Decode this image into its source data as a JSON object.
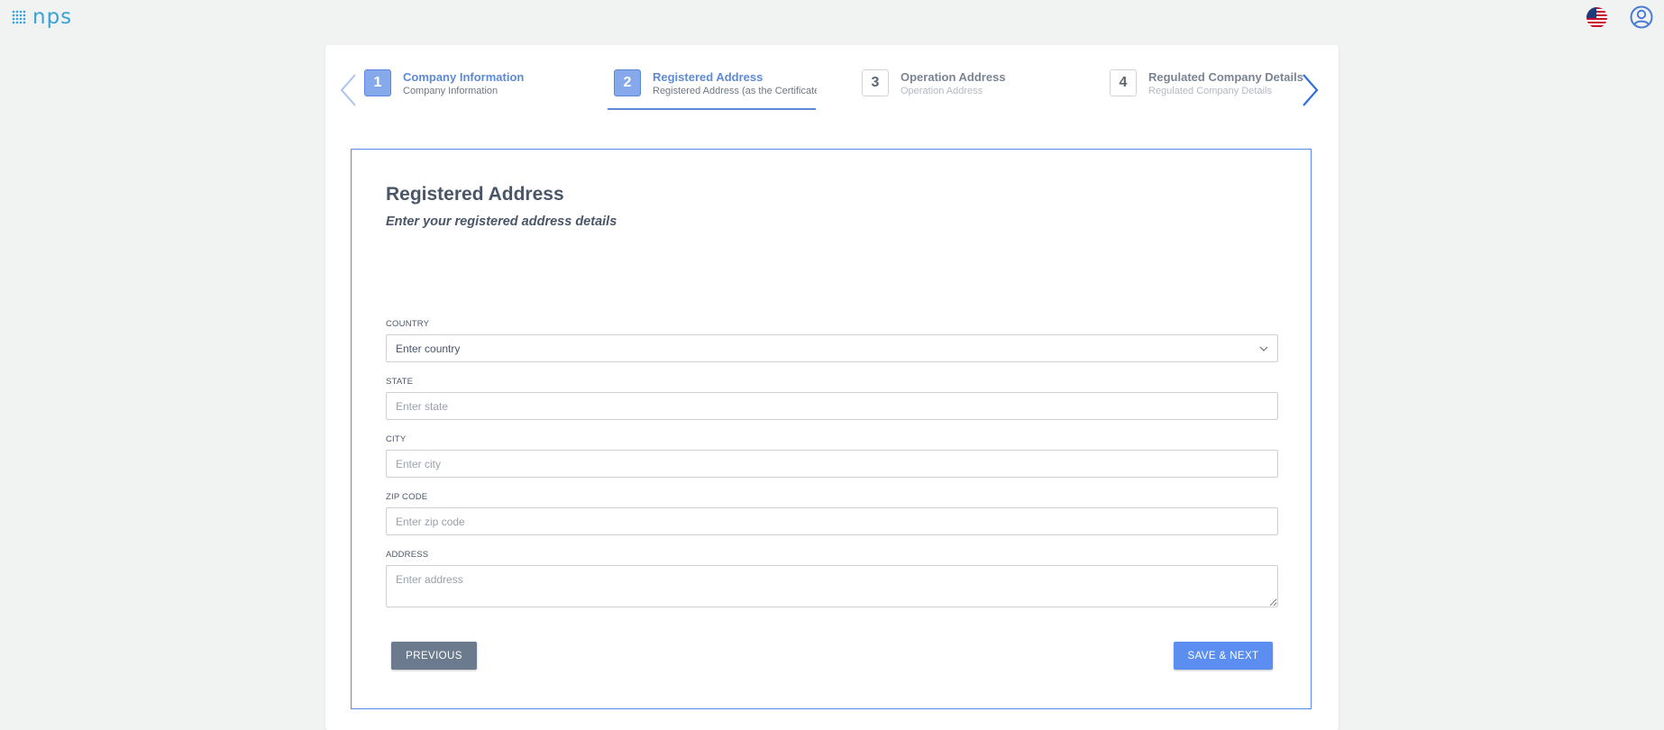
{
  "app": {
    "logo_text": "nps"
  },
  "header": {
    "flag_icon": "us-flag-icon",
    "user_icon": "user-icon"
  },
  "stepper": {
    "steps": [
      {
        "number": "1",
        "title": "Company Information",
        "subtitle": "Company Information",
        "state": "done"
      },
      {
        "number": "2",
        "title": "Registered Address",
        "subtitle": "Registered Address (as the Certificate of",
        "state": "active"
      },
      {
        "number": "3",
        "title": "Operation Address",
        "subtitle": "Operation Address",
        "state": "pending"
      },
      {
        "number": "4",
        "title": "Regulated Company Details",
        "subtitle": "Regulated Company Details",
        "state": "pending"
      }
    ]
  },
  "form": {
    "title": "Registered Address",
    "subtitle": "Enter your registered address details",
    "fields": {
      "country": {
        "label": "COUNTRY",
        "value": "Enter country"
      },
      "state": {
        "label": "STATE",
        "placeholder": "Enter state"
      },
      "city": {
        "label": "CITY",
        "placeholder": "Enter city"
      },
      "zip": {
        "label": "ZIP CODE",
        "placeholder": "Enter zip code"
      },
      "address": {
        "label": "ADDRESS",
        "placeholder": "Enter address"
      }
    },
    "buttons": {
      "previous": "PREVIOUS",
      "save_next": "SAVE & NEXT"
    }
  },
  "colors": {
    "accent": "#5b8ef0",
    "border": "#5a87e8",
    "step_active": "#86a9eb",
    "secondary_button": "#6b7a8c"
  }
}
